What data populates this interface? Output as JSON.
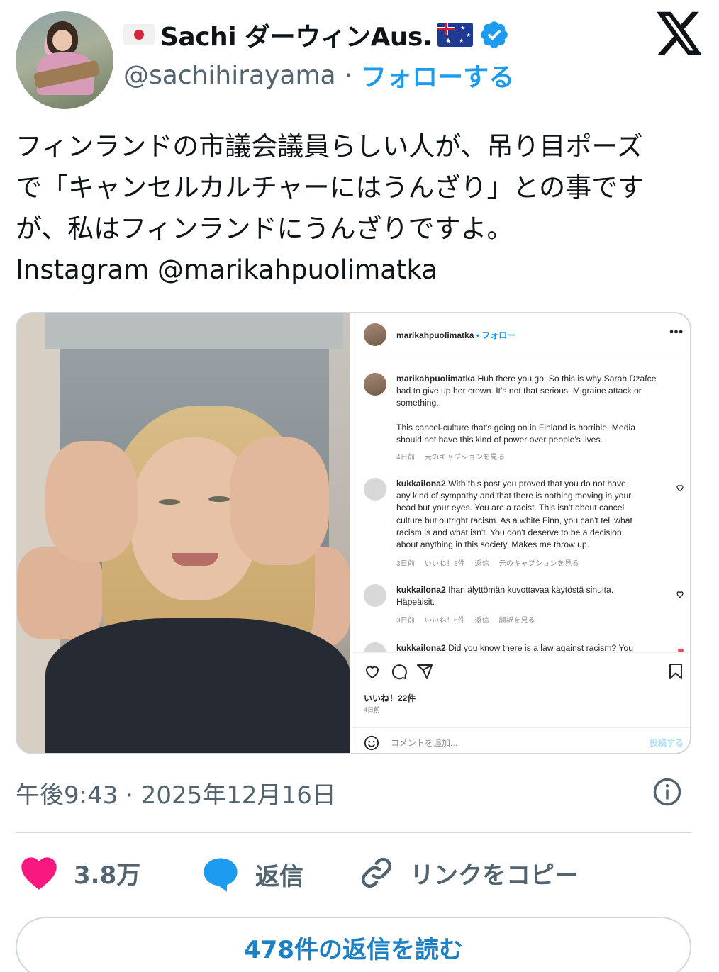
{
  "author": {
    "display_name": "Sachi ダーウィンAus.",
    "handle": "@sachihirayama",
    "separator": "·",
    "follow_label": "フォローする"
  },
  "tweet": {
    "lines": [
      "フィンランドの市議会議員らしい人が、吊り目ポーズ",
      "で「キャンセルカルチャーにはうんざり」との事です",
      "が、私はフィンランドにうんざりですよ。",
      "Instagram @marikahpuolimatka"
    ]
  },
  "instagram": {
    "username": "marikahpuolimatka",
    "dot": "•",
    "follow_label": "フォロー",
    "more": "•••",
    "caption": {
      "user": "marikahpuolimatka",
      "lines": [
        " Huh there you go. So this is why Sarah Dzafce",
        "had to give up her crown. It's not that serious. Migraine attack or",
        "something..",
        "",
        "This cancel-culture that's going on in Finland is horrible. Media",
        "should not have this kind of power over people's lives."
      ],
      "meta": "4日前　 元のキャプションを見る"
    },
    "comments": [
      {
        "user": "kukkailona2",
        "lines": [
          " With this post you proved that you do not have",
          "any kind of sympathy and that there is nothing moving in your",
          "head but your eyes. You are a racist. This isn't about cancel",
          "culture but outright racism. As a white Finn, you can't tell what",
          "racism is and what isn't. You don't deserve to be a decision",
          "about anything in this society. Makes me throw up."
        ],
        "meta": "3日前　 いいね！8件　 返信　 元のキャプションを見る"
      },
      {
        "user": "kukkailona2",
        "lines": [
          " Ihan älyttömän kuvottavaa käytöstä sinulta.",
          "Häpeäisit."
        ],
        "meta": "3日前　 いいね！6件　 返信　 翻訳を見る"
      },
      {
        "user": "kukkailona2",
        "lines": [
          " Did you know there is a law against racism? You"
        ],
        "meta": ""
      }
    ],
    "likes": "いいね！22件",
    "date": "4日前",
    "add_comment_placeholder": "コメントを追加...",
    "post_label": "投稿する"
  },
  "timestamp": "午後9:43 · 2025年12月16日",
  "actions": {
    "like_count": "3.8万",
    "reply_label": "返信",
    "copy_link_label": "リンクをコピー"
  },
  "read_replies_label": "478件の返信を読む",
  "colors": {
    "accent": "#1d9bf0",
    "like": "#f91880",
    "text_secondary": "#536471"
  }
}
